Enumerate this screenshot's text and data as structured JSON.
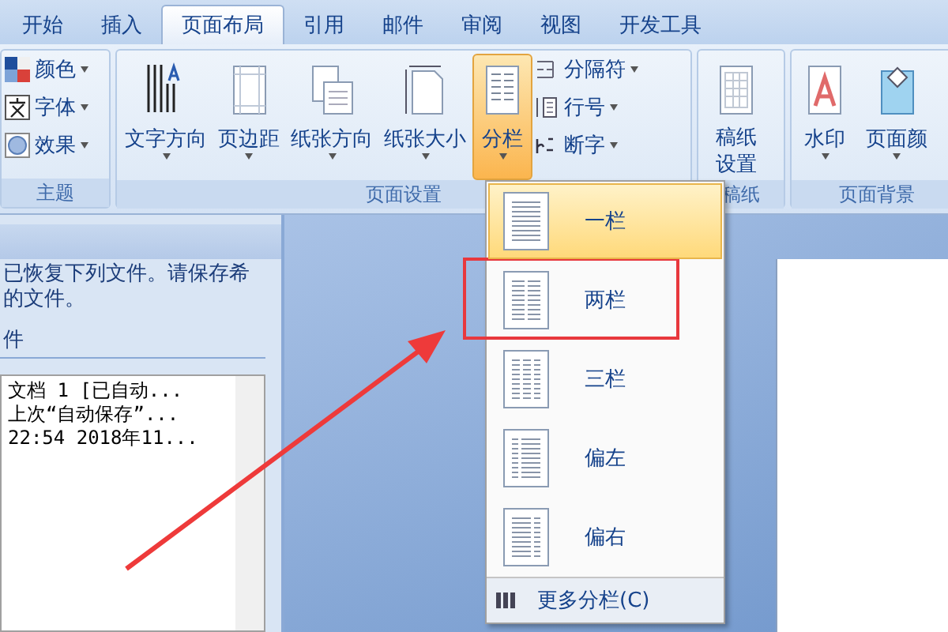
{
  "tabs": [
    {
      "label": "开始",
      "selected": false
    },
    {
      "label": "插入",
      "selected": false
    },
    {
      "label": "页面布局",
      "selected": true
    },
    {
      "label": "引用",
      "selected": false
    },
    {
      "label": "邮件",
      "selected": false
    },
    {
      "label": "审阅",
      "selected": false
    },
    {
      "label": "视图",
      "selected": false
    },
    {
      "label": "开发工具",
      "selected": false
    }
  ],
  "theme_group": {
    "label": "主题",
    "items": [
      {
        "label": "颜色",
        "kind": "colors"
      },
      {
        "label": "字体",
        "kind": "fonts"
      },
      {
        "label": "效果",
        "kind": "effects"
      }
    ]
  },
  "page_setup_group": {
    "label": "页面设置",
    "buttons": [
      {
        "label": "文字方向",
        "kind": "direction",
        "selected": false
      },
      {
        "label": "页边距",
        "kind": "margins",
        "selected": false
      },
      {
        "label": "纸张方向",
        "kind": "orientation",
        "selected": false
      },
      {
        "label": "纸张大小",
        "kind": "size",
        "selected": false
      },
      {
        "label": "分栏",
        "kind": "columns",
        "selected": true
      }
    ],
    "small_buttons": [
      {
        "label": "分隔符",
        "kind": "breaks"
      },
      {
        "label": "行号",
        "kind": "numbers"
      },
      {
        "label": "断字",
        "kind": "hyphen"
      }
    ]
  },
  "manuscript_group": {
    "label": "稿纸",
    "button": "稿纸设置"
  },
  "background_group": {
    "label": "页面背景",
    "buttons": [
      {
        "label": "水印",
        "kind": "watermark"
      },
      {
        "label": "页面颜",
        "kind": "color"
      }
    ]
  },
  "recovery_pane": {
    "message_lines": [
      "已恢复下列文件。请保存希",
      "的文件。"
    ],
    "heading": "件",
    "file_lines": [
      "文档 1  [已自动...",
      "上次“自动保存”...",
      "22:54 2018年11..."
    ]
  },
  "columns_menu": {
    "items": [
      {
        "label": "一栏",
        "kind": "one",
        "selected": true
      },
      {
        "label": "两栏",
        "kind": "two",
        "selected": false
      },
      {
        "label": "三栏",
        "kind": "three",
        "selected": false
      },
      {
        "label": "偏左",
        "kind": "left",
        "selected": false
      },
      {
        "label": "偏右",
        "kind": "right",
        "selected": false
      }
    ],
    "more": "更多分栏(C)"
  }
}
